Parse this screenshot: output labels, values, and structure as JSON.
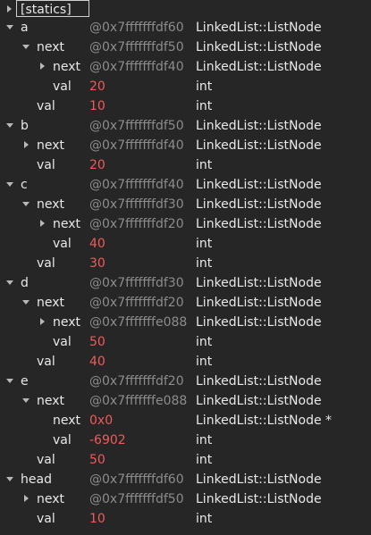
{
  "statics": {
    "label": "[statics]"
  },
  "rows": [
    {
      "name": "a",
      "value": "@0x7fffffffdf60",
      "type": "LinkedList::ListNode"
    },
    {
      "name": "next",
      "value": "@0x7fffffffdf50",
      "type": "LinkedList::ListNode"
    },
    {
      "name": "next",
      "value": "@0x7fffffffdf40",
      "type": "LinkedList::ListNode"
    },
    {
      "name": "val",
      "value": "20",
      "type": "int"
    },
    {
      "name": "val",
      "value": "10",
      "type": "int"
    },
    {
      "name": "b",
      "value": "@0x7fffffffdf50",
      "type": "LinkedList::ListNode"
    },
    {
      "name": "next",
      "value": "@0x7fffffffdf40",
      "type": "LinkedList::ListNode"
    },
    {
      "name": "val",
      "value": "20",
      "type": "int"
    },
    {
      "name": "c",
      "value": "@0x7fffffffdf40",
      "type": "LinkedList::ListNode"
    },
    {
      "name": "next",
      "value": "@0x7fffffffdf30",
      "type": "LinkedList::ListNode"
    },
    {
      "name": "next",
      "value": "@0x7fffffffdf20",
      "type": "LinkedList::ListNode"
    },
    {
      "name": "val",
      "value": "40",
      "type": "int"
    },
    {
      "name": "val",
      "value": "30",
      "type": "int"
    },
    {
      "name": "d",
      "value": "@0x7fffffffdf30",
      "type": "LinkedList::ListNode"
    },
    {
      "name": "next",
      "value": "@0x7fffffffdf20",
      "type": "LinkedList::ListNode"
    },
    {
      "name": "next",
      "value": "@0x7fffffffe088",
      "type": "LinkedList::ListNode"
    },
    {
      "name": "val",
      "value": "50",
      "type": "int"
    },
    {
      "name": "val",
      "value": "40",
      "type": "int"
    },
    {
      "name": "e",
      "value": "@0x7fffffffdf20",
      "type": "LinkedList::ListNode"
    },
    {
      "name": "next",
      "value": "@0x7fffffffe088",
      "type": "LinkedList::ListNode"
    },
    {
      "name": "next",
      "value": "0x0",
      "type": "LinkedList::ListNode *"
    },
    {
      "name": "val",
      "value": "-6902",
      "type": "int"
    },
    {
      "name": "val",
      "value": "50",
      "type": "int"
    },
    {
      "name": "head",
      "value": "@0x7fffffffdf60",
      "type": "LinkedList::ListNode"
    },
    {
      "name": "next",
      "value": "@0x7fffffffdf50",
      "type": "LinkedList::ListNode"
    },
    {
      "name": "val",
      "value": "10",
      "type": "int"
    }
  ],
  "colors": {
    "background": "#262626",
    "address": "#8c8c8c",
    "number": "#f05a5a",
    "text": "#e8e8e8"
  }
}
